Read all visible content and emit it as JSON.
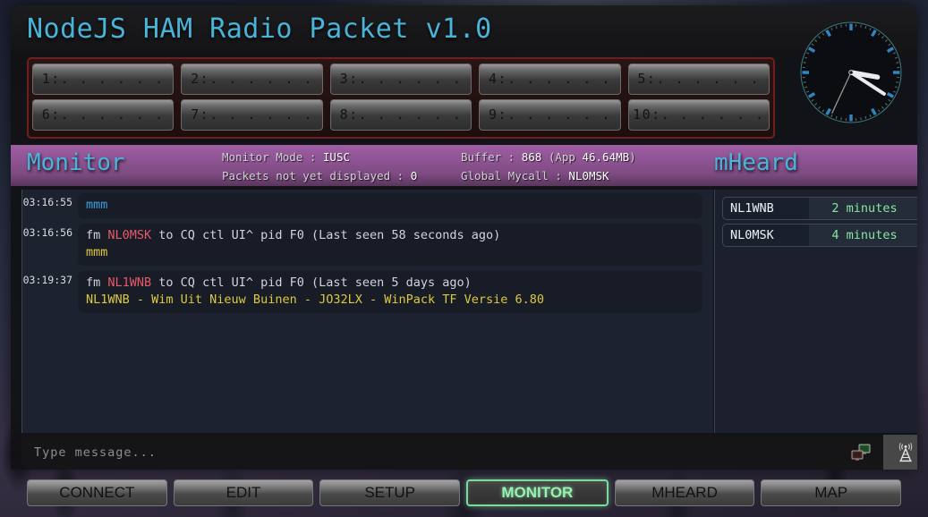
{
  "window": {
    "app_title": "NodeJS HAM Radio Packet v1.0"
  },
  "clock": {
    "icon": "analog-clock",
    "hour_hand_deg": 100,
    "minute_hand_deg": 123,
    "second_hand_deg": 205,
    "marker_color": "#2f86c4",
    "rim_color": "#3e7d80"
  },
  "channels": {
    "row1": [
      {
        "label": "1:. . . . . ."
      },
      {
        "label": "2:. . . . . ."
      },
      {
        "label": "3:. . . . . ."
      },
      {
        "label": "4:. . . . . ."
      },
      {
        "label": "5:. . . . . ."
      }
    ],
    "row2": [
      {
        "label": "6:. . . . . ."
      },
      {
        "label": "7:. . . . . ."
      },
      {
        "label": "8:. . . . . ."
      },
      {
        "label": "9:. . . . . ."
      },
      {
        "label": "10:. . . . . ."
      }
    ]
  },
  "section_header": {
    "monitor_title": "Monitor",
    "mheard_title": "mHeard",
    "monitor_mode_label": "Monitor Mode : ",
    "monitor_mode_value": "IUSC",
    "packets_label": "Packets not yet displayed : ",
    "packets_value": "0",
    "buffer_label": "Buffer : ",
    "buffer_value": "868",
    "buffer_app_label": " (App ",
    "buffer_app_value": "46.64MB",
    "buffer_app_close": ")",
    "mycall_label": "Global Mycall : ",
    "mycall_value": "NL0MSK"
  },
  "monitor_log": [
    {
      "time": "03:16:55",
      "lines": [
        [
          {
            "text": "mmm",
            "style": "rx"
          }
        ]
      ]
    },
    {
      "time": "03:16:56",
      "lines": [
        [
          {
            "text": "fm ",
            "style": "plain"
          },
          {
            "text": "NL0MSK",
            "style": "call"
          },
          {
            "text": " to CQ ctl UI^ pid F0 (Last seen 58 seconds ago)",
            "style": "plain"
          }
        ],
        [
          {
            "text": "mmm",
            "style": "info"
          }
        ]
      ]
    },
    {
      "time": "03:19:37",
      "lines": [
        [
          {
            "text": "fm ",
            "style": "plain"
          },
          {
            "text": "NL1WNB",
            "style": "call"
          },
          {
            "text": " to CQ ctl UI^ pid F0 (Last seen 5 days ago)",
            "style": "plain"
          }
        ],
        [
          {
            "text": "NL1WNB - Wim Uit Nieuw Buinen - JO32LX - WinPack TF Versie 6.80",
            "style": "info"
          }
        ]
      ]
    }
  ],
  "mheard": [
    {
      "callsign": "NL1WNB",
      "age": "2 minutes"
    },
    {
      "callsign": "NL0MSK",
      "age": "4 minutes"
    }
  ],
  "input_bar": {
    "placeholder": "Type message...",
    "value": "",
    "windows_icon": "multi-window-icon",
    "tower_icon": "radio-tower-icon"
  },
  "nav": [
    {
      "label": "CONNECT",
      "active": false
    },
    {
      "label": "EDIT",
      "active": false
    },
    {
      "label": "SETUP",
      "active": false
    },
    {
      "label": "MONITOR",
      "active": true
    },
    {
      "label": "MHEARD",
      "active": false
    },
    {
      "label": "MAP",
      "active": false
    }
  ],
  "colors": {
    "title_cyan": "#49b3d8",
    "header_purple": "#8d5391",
    "callsign_red": "#e8596a",
    "info_yellow": "#ddc83f",
    "rx_blue": "#3a9fe0",
    "mheard_green": "#86e6a2",
    "active_green": "#96f2ae",
    "channel_border_red": "#6e1f1f"
  }
}
